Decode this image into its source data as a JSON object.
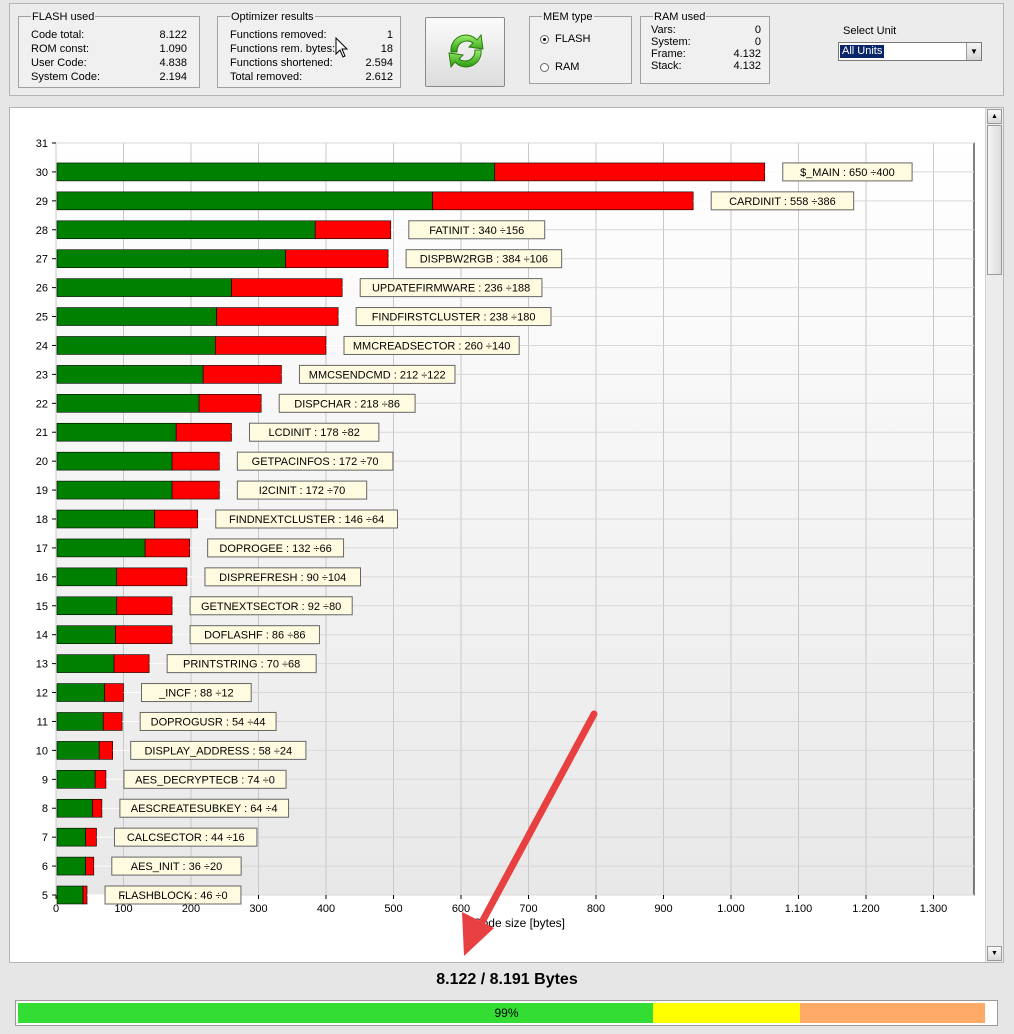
{
  "flash_used": {
    "title": "FLASH used",
    "rows": [
      {
        "label": "Code total:",
        "value": "8.122"
      },
      {
        "label": "ROM const:",
        "value": "1.090"
      },
      {
        "label": "User Code:",
        "value": "4.838"
      },
      {
        "label": "System Code:",
        "value": "2.194"
      }
    ]
  },
  "optimizer": {
    "title": "Optimizer results",
    "rows": [
      {
        "label": "Functions removed:",
        "value": "1"
      },
      {
        "label": "Functions rem. bytes:",
        "value": "18"
      },
      {
        "label": "Functions shortened:",
        "value": "2.594"
      },
      {
        "label": "Total removed:",
        "value": "2.612"
      }
    ]
  },
  "refresh_button": {
    "icon": "refresh-icon"
  },
  "mem_type": {
    "title": "MEM type",
    "options": [
      {
        "label": "FLASH",
        "checked": true
      },
      {
        "label": "RAM",
        "checked": false
      }
    ]
  },
  "ram_used": {
    "title": "RAM used",
    "rows": [
      {
        "label": "Vars:",
        "value": "0"
      },
      {
        "label": "System:",
        "value": "0"
      },
      {
        "label": "Frame:",
        "value": "4.132"
      },
      {
        "label": "Stack:",
        "value": "4.132"
      }
    ]
  },
  "select_unit": {
    "label": "Select Unit",
    "value": "All Units"
  },
  "chart_data": {
    "type": "bar",
    "orientation": "horizontal",
    "stacked": true,
    "xlabel": "Code size [bytes]",
    "xlim": [
      0,
      1360
    ],
    "xticks": [
      "0",
      "100",
      "200",
      "300",
      "400",
      "500",
      "600",
      "700",
      "800",
      "900",
      "1.000",
      "1.100",
      "1.200",
      "1.300"
    ],
    "xtick_values": [
      0,
      100,
      200,
      300,
      400,
      500,
      600,
      700,
      800,
      900,
      1000,
      1100,
      1200,
      1300
    ],
    "ylim": [
      5,
      31
    ],
    "yticks": [
      "31",
      "30",
      "29",
      "28",
      "27",
      "26",
      "25",
      "24",
      "23",
      "22",
      "21",
      "20",
      "19",
      "18",
      "17",
      "16",
      "15",
      "14",
      "13",
      "12",
      "11",
      "10",
      "9",
      "8",
      "7",
      "6",
      "5"
    ],
    "grid": true,
    "colors": {
      "series1": "#008000",
      "series2": "#ff0000"
    },
    "rows": [
      {
        "y": 30,
        "label": "$_MAIN : 650 ÷400",
        "v1": 650,
        "v2": 400
      },
      {
        "y": 29,
        "label": "CARDINIT : 558 ÷386",
        "v1": 558,
        "v2": 386
      },
      {
        "y": 28,
        "label": "FATINIT : 340 ÷156",
        "v1": 384,
        "v2": 112
      },
      {
        "y": 27,
        "label": "DISPBW2RGB : 384 ÷106",
        "v1": 340,
        "v2": 152
      },
      {
        "y": 26,
        "label": "UPDATEFIRMWARE : 236 ÷188",
        "v1": 260,
        "v2": 164
      },
      {
        "y": 25,
        "label": "FINDFIRSTCLUSTER : 238 ÷180",
        "v1": 238,
        "v2": 180
      },
      {
        "y": 24,
        "label": "MMCREADSECTOR : 260 ÷140",
        "v1": 236,
        "v2": 164
      },
      {
        "y": 23,
        "label": "MMCSENDCMD : 212 ÷122",
        "v1": 218,
        "v2": 116
      },
      {
        "y": 22,
        "label": "DISPCHAR : 218 ÷86",
        "v1": 212,
        "v2": 92
      },
      {
        "y": 21,
        "label": "LCDINIT : 178 ÷82",
        "v1": 178,
        "v2": 82
      },
      {
        "y": 20,
        "label": "GETPACINFOS : 172 ÷70",
        "v1": 172,
        "v2": 70
      },
      {
        "y": 19,
        "label": "I2CINIT : 172 ÷70",
        "v1": 172,
        "v2": 70
      },
      {
        "y": 18,
        "label": "FINDNEXTCLUSTER : 146 ÷64",
        "v1": 146,
        "v2": 64
      },
      {
        "y": 17,
        "label": "DOPROGEE : 132 ÷66",
        "v1": 132,
        "v2": 66
      },
      {
        "y": 16,
        "label": "DISPREFRESH : 90 ÷104",
        "v1": 90,
        "v2": 104
      },
      {
        "y": 15,
        "label": "GETNEXTSECTOR : 92 ÷80",
        "v1": 90,
        "v2": 82
      },
      {
        "y": 14,
        "label": "DOFLASHF : 86 ÷86",
        "v1": 88,
        "v2": 84
      },
      {
        "y": 13,
        "label": "PRINTSTRING : 70 ÷68",
        "v1": 86,
        "v2": 52
      },
      {
        "y": 12,
        "label": "_INCF : 88 ÷12",
        "v1": 72,
        "v2": 28
      },
      {
        "y": 11,
        "label": "DOPROGUSR : 54 ÷44",
        "v1": 70,
        "v2": 28
      },
      {
        "y": 10,
        "label": "DISPLAY_ADDRESS : 58 ÷24",
        "v1": 64,
        "v2": 20
      },
      {
        "y": 9,
        "label": "AES_DECRYPTECB : 74 ÷0",
        "v1": 58,
        "v2": 16
      },
      {
        "y": 8,
        "label": "AESCREATESUBKEY : 64 ÷4",
        "v1": 54,
        "v2": 14
      },
      {
        "y": 7,
        "label": "CALCSECTOR : 44 ÷16",
        "v1": 44,
        "v2": 16
      },
      {
        "y": 6,
        "label": "AES_INIT : 36 ÷20",
        "v1": 44,
        "v2": 12
      },
      {
        "y": 5,
        "label": "FLASHBLOCK : 46 ÷0",
        "v1": 40,
        "v2": 6
      }
    ]
  },
  "total": {
    "text": "8.122 / 8.191 Bytes"
  },
  "progress": {
    "percent": 99,
    "label": "99%",
    "segments": [
      {
        "color": "#33dd33",
        "from": 0,
        "to": 65
      },
      {
        "color": "#ffff00",
        "from": 65,
        "to": 80
      },
      {
        "color": "#ffaa66",
        "from": 80,
        "to": 99
      }
    ]
  },
  "annotation": {
    "color": "#e84040"
  }
}
